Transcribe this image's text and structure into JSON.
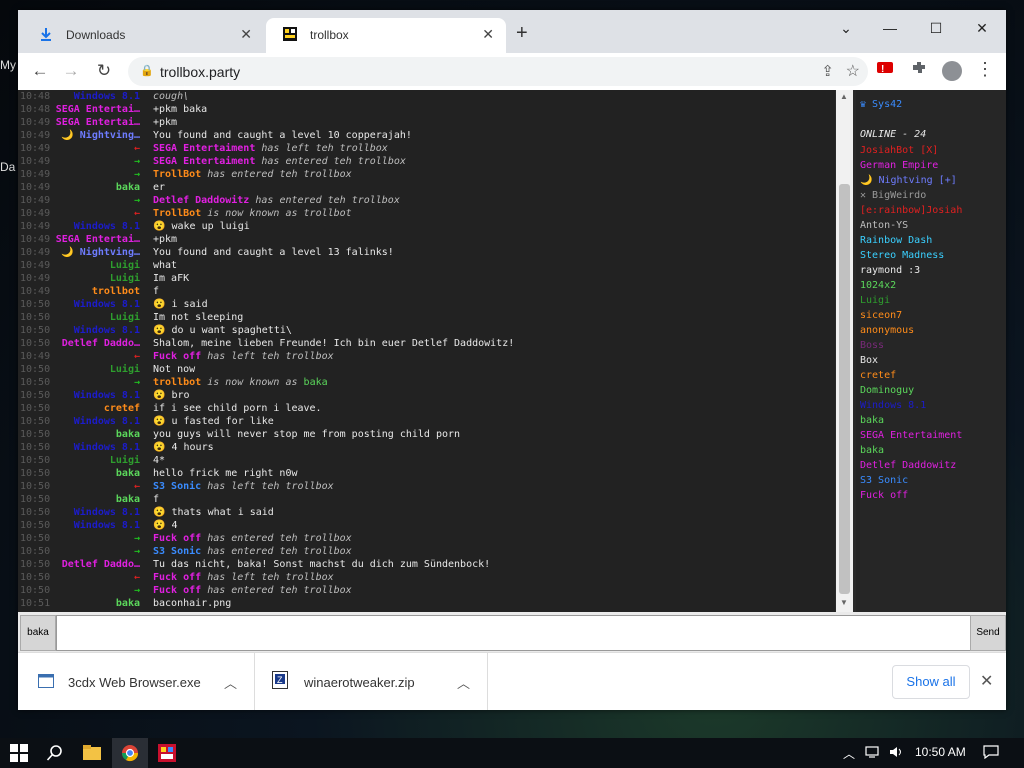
{
  "desktop": {
    "frag1": "My",
    "frag2": "Da"
  },
  "browser": {
    "tabs": [
      {
        "label": "Downloads",
        "close": "✕"
      },
      {
        "label": "trollbox",
        "close": "✕"
      }
    ],
    "new_tab": "+",
    "window": {
      "minimize": "—",
      "maximize": "☐",
      "close": "✕",
      "tab_search": "⌄"
    },
    "nav": {
      "back": "←",
      "forward": "→",
      "reload": "↻"
    },
    "url": "trollbox.party",
    "lock_icon": "🔒",
    "share_icon": "⇪",
    "star_icon": "☆",
    "menu_icon": "⋮"
  },
  "chat": {
    "rows": [
      {
        "time": "10:48",
        "nick": "Windows 8.1",
        "nick_color": "#1c1ccc",
        "msg": "cough\\",
        "italic": true
      },
      {
        "time": "10:48",
        "nick": "SEGA Entertai…",
        "nick_color": "#e020e0",
        "msg": "+pkm baka"
      },
      {
        "time": "10:49",
        "nick": "SEGA Entertai…",
        "nick_color": "#e020e0",
        "msg": "+pkm"
      },
      {
        "time": "10:49",
        "nick": "🌙 Nightving…",
        "nick_color": "#6e7cff",
        "msg": "You found and caught a level 10 copperajah!"
      },
      {
        "time": "10:49",
        "nick": "←",
        "nick_color": "#e02020",
        "pre": "SEGA Entertaiment",
        "pre_color": "#e020e0",
        "msg": "has left teh trollbox",
        "italic": true
      },
      {
        "time": "10:49",
        "nick": "→",
        "nick_color": "#20c020",
        "pre": "SEGA Entertaiment",
        "pre_color": "#e020e0",
        "msg": "has entered teh trollbox",
        "italic": true
      },
      {
        "time": "10:49",
        "nick": "→",
        "nick_color": "#20c020",
        "pre": "TrollBot",
        "pre_color": "#ff8c1a",
        "msg": "has entered teh trollbox",
        "italic": true
      },
      {
        "time": "10:49",
        "nick": "baka",
        "nick_color": "#5bd75b",
        "msg": "er"
      },
      {
        "time": "10:49",
        "nick": "→",
        "nick_color": "#20c020",
        "pre": "Detlef Daddowitz",
        "pre_color": "#e020e0",
        "msg": "has entered teh trollbox",
        "italic": true
      },
      {
        "time": "10:49",
        "nick": "←",
        "nick_color": "#e02020",
        "pre": "TrollBot",
        "pre_color": "#ff8c1a",
        "msg": "is now known as trollbot",
        "italic": true
      },
      {
        "time": "10:49",
        "nick": "Windows 8.1",
        "nick_color": "#1c1ccc",
        "msg": "😮 wake up luigi"
      },
      {
        "time": "10:49",
        "nick": "SEGA Entertai…",
        "nick_color": "#e020e0",
        "msg": "+pkm"
      },
      {
        "time": "10:49",
        "nick": "🌙 Nightving…",
        "nick_color": "#6e7cff",
        "msg": "You found and caught a level 13 falinks!"
      },
      {
        "time": "10:49",
        "nick": "Luigi",
        "nick_color": "#2e9e2e",
        "msg": "what"
      },
      {
        "time": "10:49",
        "nick": "Luigi",
        "nick_color": "#2e9e2e",
        "msg": "Im aFK"
      },
      {
        "time": "10:49",
        "nick": "trollbot",
        "nick_color": "#ff8c1a",
        "msg": "f"
      },
      {
        "time": "10:50",
        "nick": "Windows 8.1",
        "nick_color": "#1c1ccc",
        "msg": "😮 i said"
      },
      {
        "time": "10:50",
        "nick": "Luigi",
        "nick_color": "#2e9e2e",
        "msg": "Im not sleeping"
      },
      {
        "time": "10:50",
        "nick": "Windows 8.1",
        "nick_color": "#1c1ccc",
        "msg": "😮 do u want spaghetti\\"
      },
      {
        "time": "10:50",
        "nick": "Detlef Daddo…",
        "nick_color": "#e020e0",
        "msg": "Shalom, meine lieben Freunde! Ich bin euer Detlef Daddowitz!"
      },
      {
        "time": "10:49",
        "nick": "←",
        "nick_color": "#e02020",
        "pre": "Fuck off",
        "pre_color": "#e020e0",
        "msg": "has left teh trollbox",
        "italic": true
      },
      {
        "time": "10:50",
        "nick": "Luigi",
        "nick_color": "#2e9e2e",
        "msg": "Not now"
      },
      {
        "time": "10:50",
        "nick": "→",
        "nick_color": "#20c020",
        "pre": "trollbot",
        "pre_color": "#ff8c1a",
        "msg": "is now known as",
        "italic": true,
        "post": "baka",
        "post_color": "#5bd75b"
      },
      {
        "time": "10:50",
        "nick": "Windows 8.1",
        "nick_color": "#1c1ccc",
        "msg": "😮 bro"
      },
      {
        "time": "10:50",
        "nick": "cretef",
        "nick_color": "#ff8c1a",
        "msg": "if i see child porn i leave."
      },
      {
        "time": "10:50",
        "nick": "Windows 8.1",
        "nick_color": "#1c1ccc",
        "msg": "😮 u fasted for like"
      },
      {
        "time": "10:50",
        "nick": "baka",
        "nick_color": "#5bd75b",
        "msg": "you guys will never stop me from posting child porn"
      },
      {
        "time": "10:50",
        "nick": "Windows 8.1",
        "nick_color": "#1c1ccc",
        "msg": "😮 4 hours"
      },
      {
        "time": "10:50",
        "nick": "Luigi",
        "nick_color": "#2e9e2e",
        "msg": "4*"
      },
      {
        "time": "10:50",
        "nick": "baka",
        "nick_color": "#5bd75b",
        "msg": "hello frick me right n0w"
      },
      {
        "time": "10:50",
        "nick": "←",
        "nick_color": "#e02020",
        "pre": "S3 Sonic",
        "pre_color": "#3a8cff",
        "msg": "has left teh trollbox",
        "italic": true
      },
      {
        "time": "10:50",
        "nick": "baka",
        "nick_color": "#5bd75b",
        "msg": "f"
      },
      {
        "time": "10:50",
        "nick": "Windows 8.1",
        "nick_color": "#1c1ccc",
        "msg": "😮 thats what i said"
      },
      {
        "time": "10:50",
        "nick": "Windows 8.1",
        "nick_color": "#1c1ccc",
        "msg": "😮 4"
      },
      {
        "time": "10:50",
        "nick": "→",
        "nick_color": "#20c020",
        "pre": "Fuck off",
        "pre_color": "#e020e0",
        "msg": "has entered teh trollbox",
        "italic": true
      },
      {
        "time": "10:50",
        "nick": "→",
        "nick_color": "#20c020",
        "pre": "S3 Sonic",
        "pre_color": "#3a8cff",
        "msg": "has entered teh trollbox",
        "italic": true
      },
      {
        "time": "10:50",
        "nick": "Detlef Daddo…",
        "nick_color": "#e020e0",
        "msg": "Tu das nicht, baka! Sonst machst du dich zum Sündenbock!"
      },
      {
        "time": "10:50",
        "nick": "←",
        "nick_color": "#e02020",
        "pre": "Fuck off",
        "pre_color": "#e020e0",
        "msg": "has left teh trollbox",
        "italic": true
      },
      {
        "time": "10:50",
        "nick": "→",
        "nick_color": "#20c020",
        "pre": "Fuck off",
        "pre_color": "#e020e0",
        "msg": "has entered teh trollbox",
        "italic": true
      },
      {
        "time": "10:51",
        "nick": "baka",
        "nick_color": "#5bd75b",
        "msg": "baconhair.png"
      }
    ]
  },
  "userlist": {
    "me": "♛ Sys42",
    "me_color": "#3a8cff",
    "online_label": "ONLINE - 24",
    "users": [
      {
        "name": "JosiahBot [X]",
        "color": "#e02020"
      },
      {
        "name": "German Empire",
        "color": "#e020e0"
      },
      {
        "name": "🌙 Nightving [+]",
        "color": "#6e7cff"
      },
      {
        "name": "✕ BigWeirdo",
        "color": "#9a9a9a"
      },
      {
        "name": "[e:rainbow]Josiah",
        "color": "#e02020"
      },
      {
        "name": "Anton-YS",
        "color": "#bdbdbd"
      },
      {
        "name": "Rainbow Dash",
        "color": "#3ad0ff"
      },
      {
        "name": "Stereo Madness",
        "color": "#3ad0ff"
      },
      {
        "name": "raymond :3",
        "color": "#e8e8e8"
      },
      {
        "name": "1024x2",
        "color": "#5bd75b"
      },
      {
        "name": "Luigi",
        "color": "#2e9e2e"
      },
      {
        "name": "siceon7",
        "color": "#ff8c1a"
      },
      {
        "name": "anonymous",
        "color": "#ff8c1a"
      },
      {
        "name": "Boss",
        "color": "#7a2a7a"
      },
      {
        "name": "Box",
        "color": "#e8e8e8"
      },
      {
        "name": "cretef",
        "color": "#ff8c1a"
      },
      {
        "name": "Dominoguy",
        "color": "#5bd75b"
      },
      {
        "name": "Windows 8.1",
        "color": "#1c1ccc"
      },
      {
        "name": "baka",
        "color": "#5bd75b"
      },
      {
        "name": "SEGA Entertaiment",
        "color": "#e020e0"
      },
      {
        "name": "baka",
        "color": "#5bd75b"
      },
      {
        "name": "Detlef Daddowitz",
        "color": "#e020e0"
      },
      {
        "name": "S3 Sonic",
        "color": "#3a8cff"
      },
      {
        "name": "Fuck off",
        "color": "#e020e0"
      }
    ]
  },
  "input": {
    "nick_button": "baka",
    "send_button": "Send",
    "value": ""
  },
  "downloads": {
    "items": [
      {
        "name": "3cdx Web Browser.exe"
      },
      {
        "name": "winaerotweaker.zip"
      }
    ],
    "show_all": "Show all",
    "close": "✕"
  },
  "taskbar": {
    "clock": "10:50 AM"
  }
}
